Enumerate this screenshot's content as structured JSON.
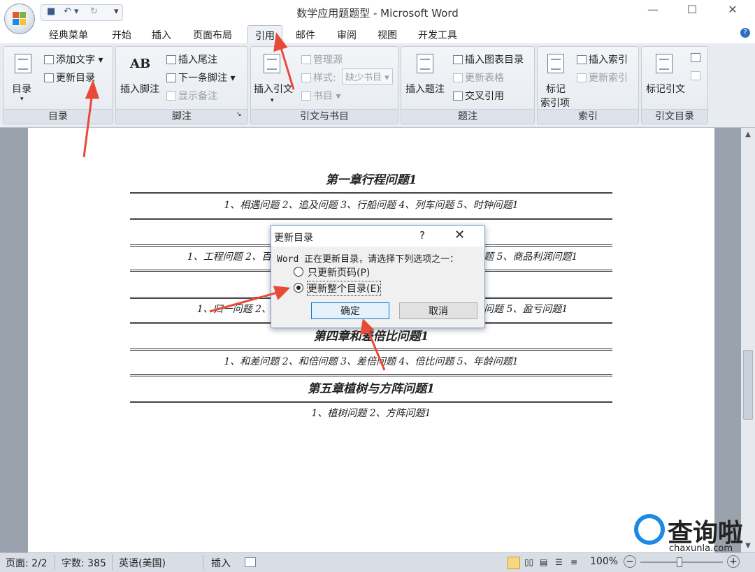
{
  "window": {
    "title": "数学应用题题型 - Microsoft Word",
    "minimize": "—",
    "maximize": "☐",
    "close": "✕"
  },
  "qat": {
    "save": "■",
    "undo": "↶ ▾",
    "redo": "↻",
    "more": "▾"
  },
  "tabs": [
    "经典菜单",
    "开始",
    "插入",
    "页面布局",
    "引用",
    "邮件",
    "审阅",
    "视图",
    "开发工具"
  ],
  "active_tab": "引用",
  "ribbon": {
    "toc": {
      "big": "目录",
      "add_text": "添加文字",
      "update": "更新目录",
      "label": "目录"
    },
    "footnote": {
      "insert": "插入脚注",
      "endnote": "插入尾注",
      "next": "下一条脚注",
      "show": "显示备注",
      "label": "脚注",
      "ab_icon": "AB"
    },
    "citation": {
      "insert": "插入引文",
      "manage": "管理源",
      "style_label": "样式:",
      "style_value": "缺少书目",
      "biblio": "书目",
      "label": "引文与书目"
    },
    "caption": {
      "insert": "插入题注",
      "table_of_figures": "插入图表目录",
      "update_table": "更新表格",
      "cross_ref": "交叉引用",
      "label": "题注"
    },
    "index": {
      "mark_line1": "标记",
      "mark_line2": "索引项",
      "insert": "插入索引",
      "update": "更新索引",
      "label": "索引"
    },
    "toa": {
      "mark": "标记引文",
      "label": "引文目录"
    }
  },
  "document": {
    "headings": [
      "第一章行程问题1",
      "第四章和差倍比问题1",
      "第五章植树与方阵问题1"
    ],
    "entries": [
      "1、相遇问题 2、追及问题 3、行船问题 4、列车问题 5、时钟问题1",
      "1、工程问题 2、百分数",
      "题 5、商品利润问题1",
      "1、归一问题 2、归总",
      "问题 5、盈亏问题1",
      "1、和差问题 2、和倍问题 3、差倍问题 4、倍比问题 5、年龄问题1",
      "1、植树问题 2、方阵问题1"
    ]
  },
  "dialog": {
    "title": "更新目录",
    "help": "?",
    "close": "✕",
    "message": "Word 正在更新目录，请选择下列选项之一：",
    "option1": "只更新页码(P)",
    "option2": "更新整个目录(E)",
    "ok": "确定",
    "cancel": "取消"
  },
  "status": {
    "page": "页面: 2/2",
    "words": "字数: 385",
    "language": "英语(美国)",
    "mode": "插入",
    "zoom": "100%",
    "zoom_out": "−",
    "zoom_in": "+"
  },
  "watermark": {
    "brand": "查询啦",
    "url": "chaxunla.com"
  },
  "colors": {
    "arrow": "#e84a3a",
    "dialog_border": "#7aa0d0",
    "primary_button": "#0078d7"
  }
}
